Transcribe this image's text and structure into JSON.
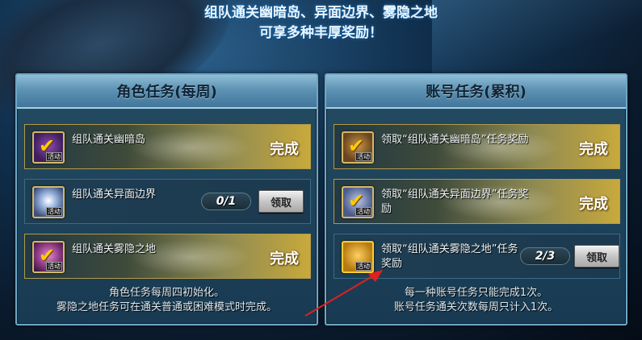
{
  "banner": {
    "line1": "组队通关幽暗岛、异面边界、雾隐之地",
    "line2": "可享多种丰厚奖励！"
  },
  "left_panel": {
    "title": "角色任务(每周)",
    "tasks": [
      {
        "label": "组队通关幽暗岛",
        "status": "完成",
        "icon": "purple-check-reward-icon"
      },
      {
        "label": "组队通关异面边界",
        "progress": "0/1",
        "button": "领取",
        "icon": "white-orb-reward-icon"
      },
      {
        "label": "组队通关雾隐之地",
        "status": "完成",
        "icon": "pink-check-reward-icon"
      }
    ],
    "icon_tag": "活动",
    "footer_line1": "角色任务每周四初始化。",
    "footer_line2": "雾隐之地任务可在通关普通或困难模式时完成。"
  },
  "right_panel": {
    "title": "账号任务(累积)",
    "tasks": [
      {
        "label": "领取“组队通关幽暗岛”任务奖励",
        "status": "完成",
        "icon": "chest-check-icon"
      },
      {
        "label": "领取“组队通关异面边界”任务奖励",
        "status": "完成",
        "icon": "blue-chest-check-icon"
      },
      {
        "label": "领取“组队通关雾隐之地”任务奖励",
        "progress": "2/3",
        "button": "领取",
        "icon": "gold-chest-icon"
      }
    ],
    "icon_tag": "活动",
    "footer_line1": "每一种账号任务只能完成1次。",
    "footer_line2": "账号任务通关次数每周只计入1次。"
  },
  "colors": {
    "accent_gold": "#c8a93c",
    "panel_bg": "#1c3a4f",
    "arrow_red": "#e02020"
  }
}
